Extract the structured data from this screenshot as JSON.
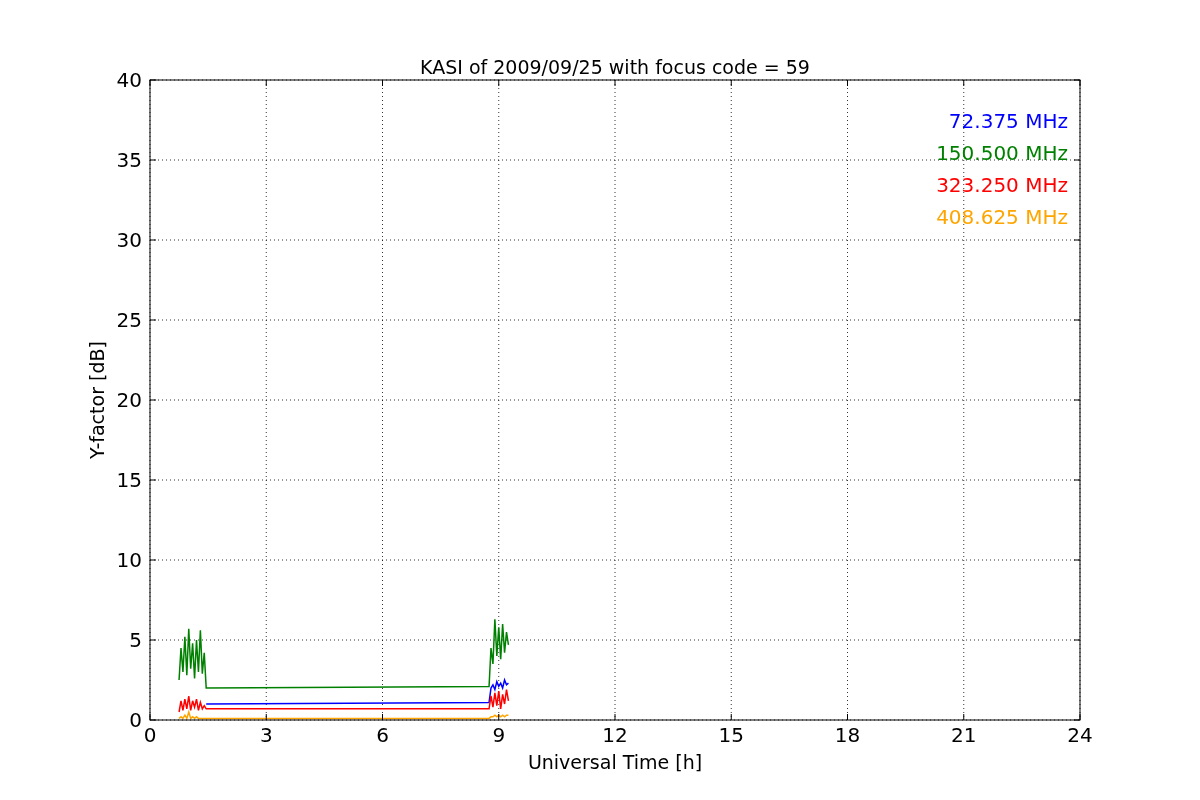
{
  "chart_data": {
    "type": "line",
    "title": "KASI of 2009/09/25 with focus code = 59",
    "xlabel": "Universal Time [h]",
    "ylabel": "Y-factor [dB]",
    "x": [
      0.75,
      0.8,
      0.85,
      0.9,
      0.95,
      1.0,
      1.05,
      1.1,
      1.15,
      1.2,
      1.25,
      1.3,
      1.35,
      1.4,
      1.45,
      8.75,
      8.8,
      8.85,
      8.9,
      8.95,
      9.0,
      9.05,
      9.1,
      9.15,
      9.2,
      9.25
    ],
    "series": [
      {
        "name": "72.375 MHz",
        "color": "#0000ff",
        "values": [
          null,
          null,
          null,
          null,
          null,
          null,
          null,
          null,
          null,
          null,
          null,
          null,
          null,
          null,
          1.0,
          1.1,
          2.0,
          2.2,
          1.9,
          2.4,
          2.1,
          2.3,
          2.0,
          2.5,
          2.2,
          2.3
        ]
      },
      {
        "name": "150.500 MHz",
        "color": "#008000",
        "values": [
          2.5,
          4.5,
          3.0,
          5.2,
          2.8,
          5.7,
          3.2,
          4.8,
          2.6,
          5.0,
          3.0,
          5.6,
          2.9,
          4.2,
          2.0,
          2.1,
          4.5,
          3.5,
          6.3,
          4.0,
          5.8,
          3.8,
          6.0,
          4.2,
          5.5,
          4.7
        ]
      },
      {
        "name": "323.250 MHz",
        "color": "#ff0000",
        "values": [
          0.5,
          1.2,
          0.6,
          1.3,
          0.7,
          1.5,
          0.6,
          1.2,
          0.8,
          1.3,
          0.6,
          1.1,
          0.7,
          0.9,
          0.7,
          0.7,
          1.5,
          0.8,
          1.7,
          0.9,
          1.8,
          0.7,
          1.6,
          1.0,
          1.9,
          1.2
        ]
      },
      {
        "name": "408.625 MHz",
        "color": "#ffa500",
        "values": [
          0.1,
          0.2,
          0.1,
          0.3,
          0.1,
          0.5,
          0.1,
          0.2,
          0.1,
          0.2,
          0.1,
          0.1,
          0.1,
          0.1,
          0.1,
          0.1,
          0.2,
          0.2,
          0.3,
          0.2,
          0.3,
          0.2,
          0.3,
          0.2,
          0.3,
          0.3
        ]
      }
    ],
    "grid": true,
    "xlim": [
      0,
      24
    ],
    "ylim": [
      0,
      40
    ],
    "xticks": [
      0,
      3,
      6,
      9,
      12,
      15,
      18,
      21,
      24
    ],
    "yticks": [
      0,
      5,
      10,
      15,
      20,
      25,
      30,
      35,
      40
    ]
  }
}
